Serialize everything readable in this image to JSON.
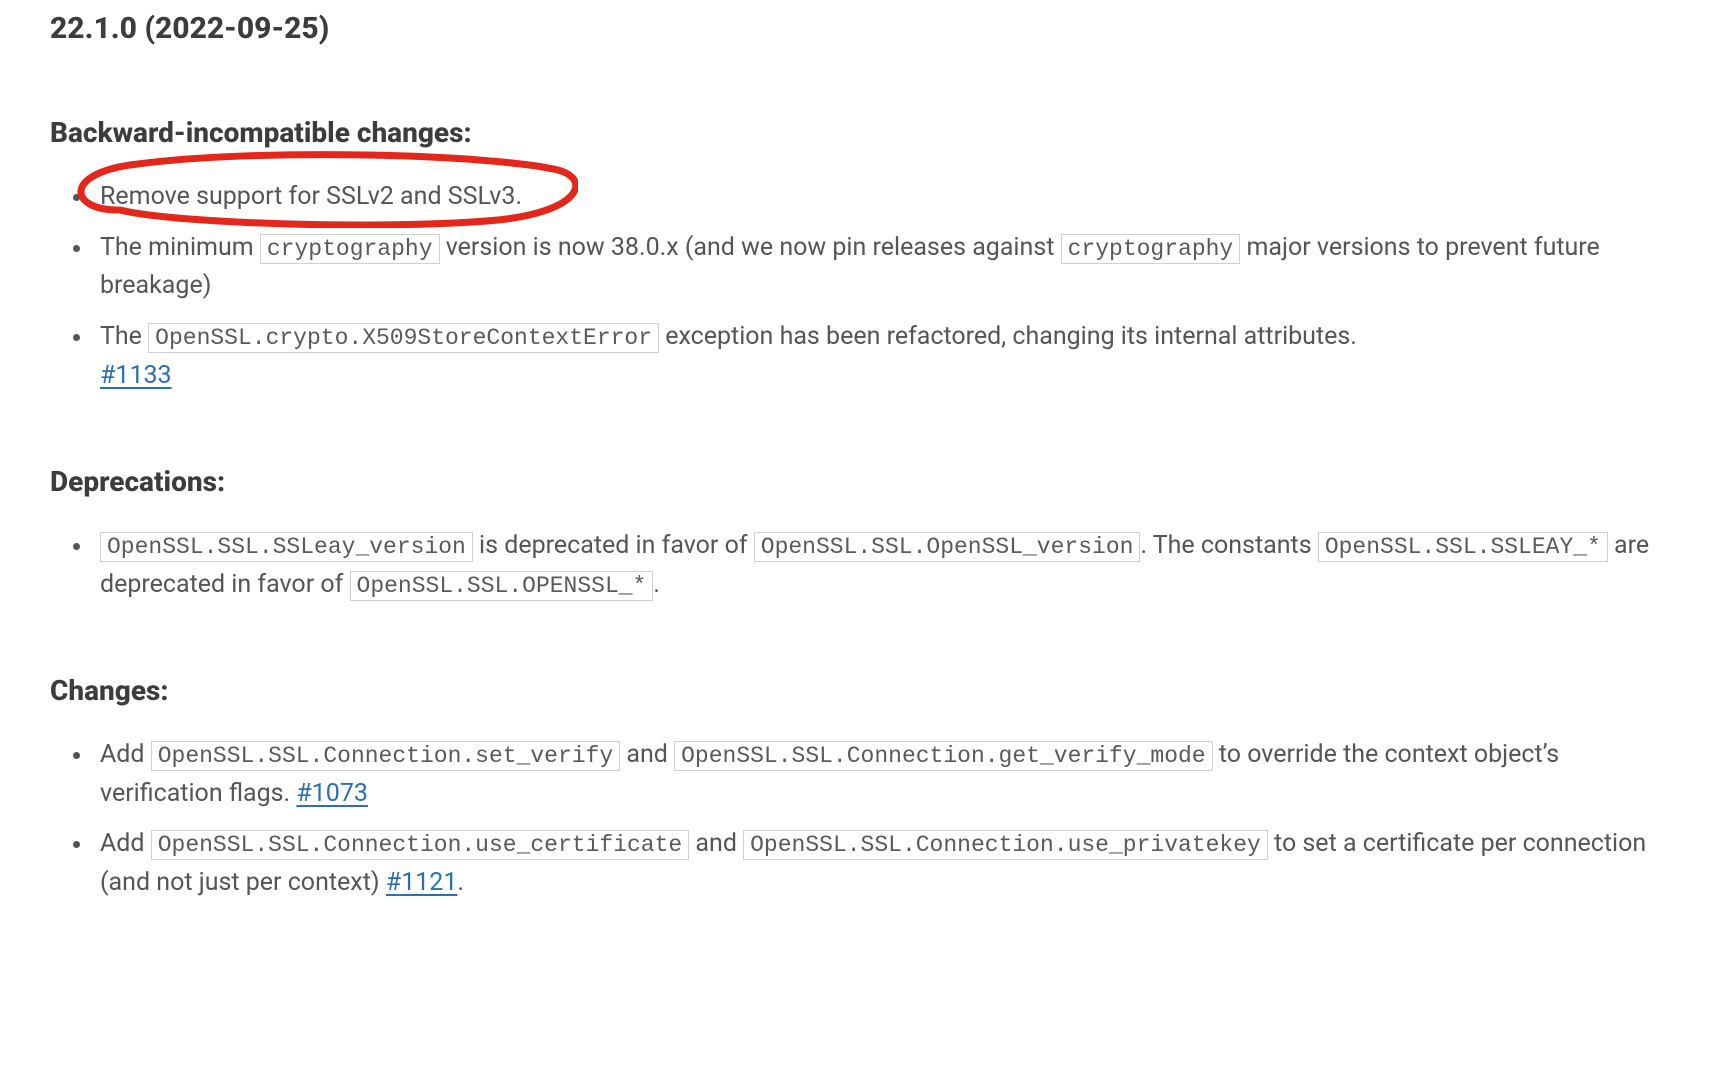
{
  "version_heading": "22.1.0 (2022-09-25)",
  "sections": {
    "backward": {
      "title": "Backward-incompatible changes:",
      "items": {
        "0": {
          "text": "Remove support for SSLv2 and SSLv3."
        },
        "1": {
          "pre1": "The minimum ",
          "code1": "cryptography",
          "mid1": " version is now 38.0.x (and we now pin releases against ",
          "code2": "cryptography",
          "post1": " major versions to prevent future breakage)"
        },
        "2": {
          "pre1": "The ",
          "code1": "OpenSSL.crypto.X509StoreContextError",
          "post1": " exception has been refactored, changing its internal attributes. ",
          "link_label": "#1133"
        }
      }
    },
    "deprecations": {
      "title": "Deprecations:",
      "items": {
        "0": {
          "code1": "OpenSSL.SSL.SSLeay_version",
          "mid1": " is deprecated in favor of ",
          "code2": "OpenSSL.SSL.OpenSSL_version",
          "mid2": ". The constants ",
          "code3": "OpenSSL.SSL.SSLEAY_*",
          "mid3": " are deprecated in favor of ",
          "code4": "OpenSSL.SSL.OPENSSL_*",
          "post": "."
        }
      }
    },
    "changes": {
      "title": "Changes:",
      "items": {
        "0": {
          "pre": "Add ",
          "code1": "OpenSSL.SSL.Connection.set_verify",
          "mid1": " and ",
          "code2": "OpenSSL.SSL.Connection.get_verify_mode",
          "post": " to override the context object’s verification flags. ",
          "link_label": "#1073"
        },
        "1": {
          "pre": "Add ",
          "code1": "OpenSSL.SSL.Connection.use_certificate",
          "mid1": " and ",
          "code2": "OpenSSL.SSL.Connection.use_privatekey",
          "post": " to set a certificate per connection (and not just per context) ",
          "link_label": "#1121",
          "tail": "."
        }
      }
    }
  }
}
